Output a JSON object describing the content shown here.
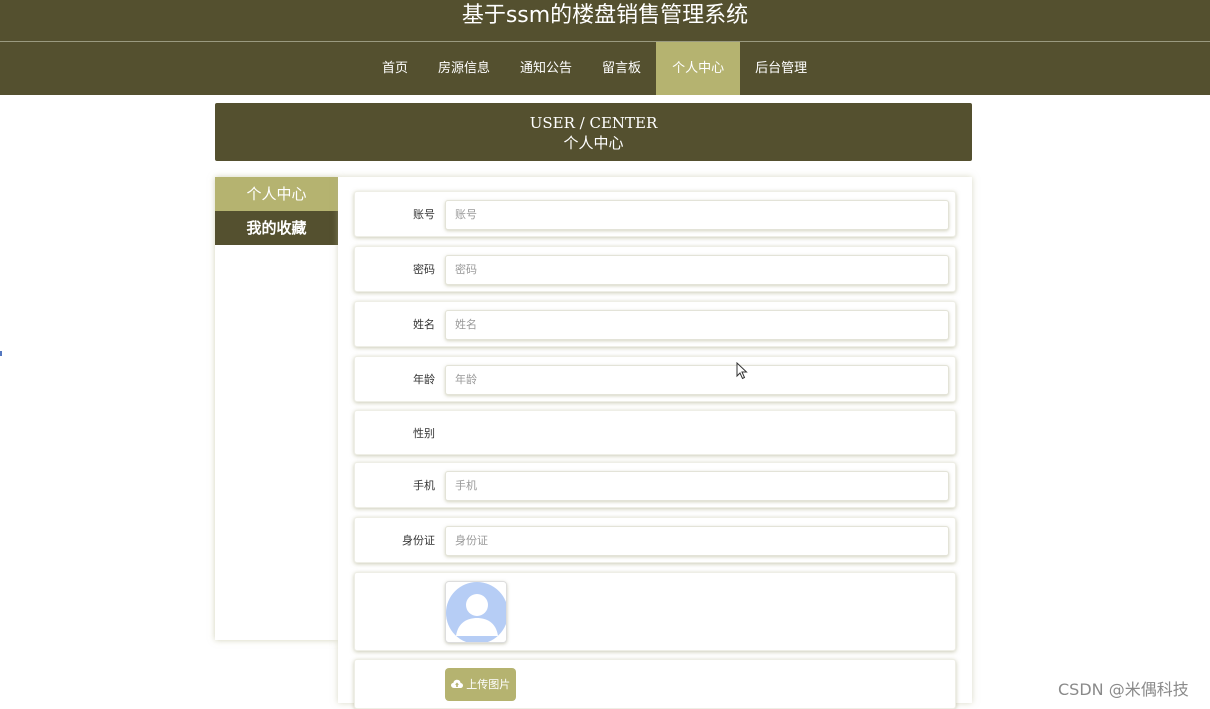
{
  "header": {
    "title": "基于ssm的楼盘销售管理系统"
  },
  "nav": {
    "items": [
      {
        "label": "首页"
      },
      {
        "label": "房源信息"
      },
      {
        "label": "通知公告"
      },
      {
        "label": "留言板"
      },
      {
        "label": "个人中心",
        "active": true
      },
      {
        "label": "后台管理"
      }
    ]
  },
  "banner": {
    "en": "USER / CENTER",
    "cn": "个人中心"
  },
  "sidebar": {
    "items": [
      {
        "label": "个人中心",
        "active": true
      },
      {
        "label": "我的收藏"
      }
    ]
  },
  "form": {
    "account": {
      "label": "账号",
      "placeholder": "账号"
    },
    "password": {
      "label": "密码",
      "placeholder": "密码"
    },
    "name": {
      "label": "姓名",
      "placeholder": "姓名"
    },
    "age": {
      "label": "年龄",
      "placeholder": "年龄"
    },
    "gender": {
      "label": "性别"
    },
    "phone": {
      "label": "手机",
      "placeholder": "手机"
    },
    "idcard": {
      "label": "身份证",
      "placeholder": "身份证"
    },
    "upload_label": "上传图片"
  },
  "icons": {
    "avatar": "default-avatar-icon",
    "upload": "cloud-upload-icon",
    "cursor": "mouse-pointer-icon"
  },
  "colors": {
    "primary_dark": "#54502f",
    "accent": "#b5b370",
    "avatar_blue": "#b6cdf5"
  },
  "watermark": "CSDN @米偶科技"
}
